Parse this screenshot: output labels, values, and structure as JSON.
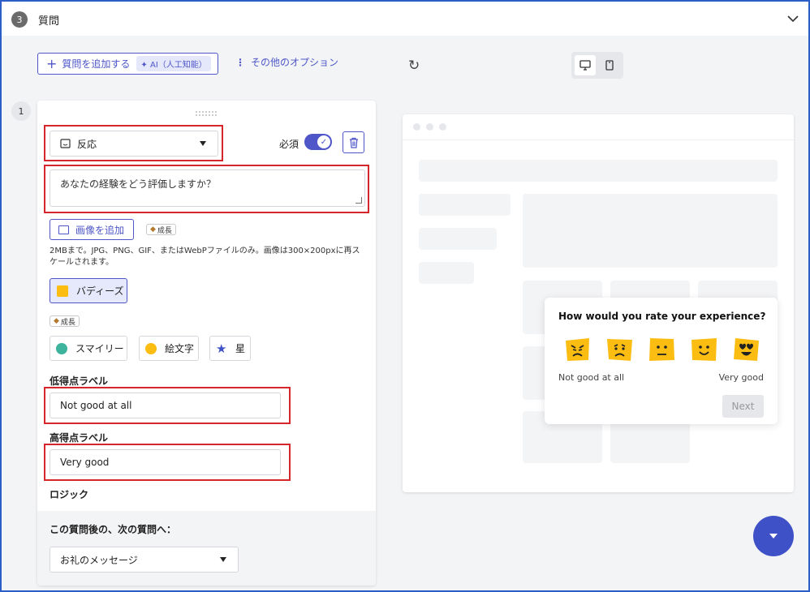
{
  "header": {
    "step_number": "3",
    "title": "質問"
  },
  "toolbar": {
    "add_question_label": "質問を追加する",
    "ai_label": "AI（人工知能）",
    "more_options_label": "その他のオプション"
  },
  "question": {
    "number": "1",
    "type_label": "反応",
    "required_label": "必須",
    "required_on": true,
    "text": "あなたの経験をどう評価しますか？",
    "add_image_label": "画像を追加",
    "growth_label": "成長",
    "help_text": "2MBまで。JPG、PNG、GIF、またはWebPファイルのみ。画像は300×200pxに再スケールされます。",
    "styles": {
      "buddies": "バディーズ",
      "smiley": "スマイリー",
      "emoji": "絵文字",
      "star": "星"
    },
    "low_label_title": "低得点ラベル",
    "low_label_value": "Not good at all",
    "high_label_title": "高得点ラベル",
    "high_label_value": "Very good",
    "logic_title": "ロジック",
    "after_question_label": "この質問後の、次の質問へ：",
    "next_question_value": "お礼のメッセージ"
  },
  "preview": {
    "question": "How would you rate your experience?",
    "low_label": "Not good at all",
    "high_label": "Very good",
    "next_label": "Next",
    "faces": [
      "angry-face-icon",
      "sad-face-icon",
      "neutral-face-icon",
      "happy-face-icon",
      "love-face-icon"
    ]
  },
  "colors": {
    "accent": "#4e56c8",
    "highlight_red": "#d6262b",
    "face_yellow": "#fbbd12",
    "fab": "#3f51c7"
  }
}
